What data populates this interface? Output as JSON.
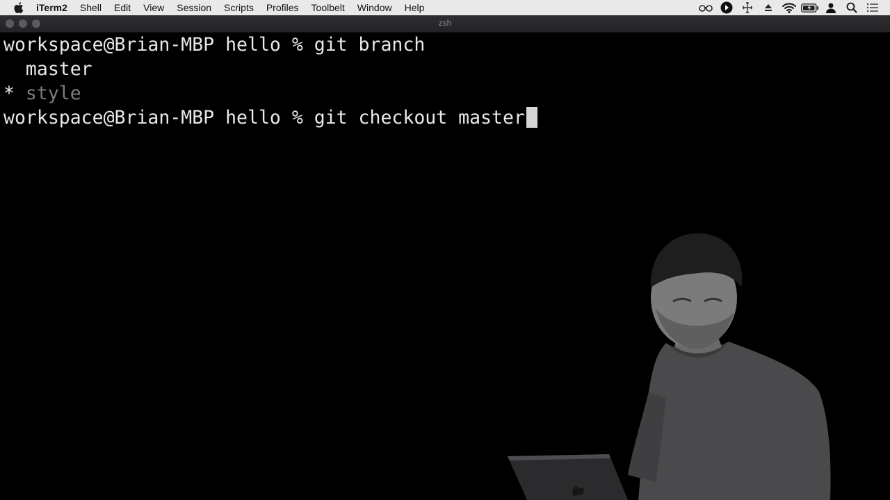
{
  "menubar": {
    "app_name": "iTerm2",
    "items": [
      "Shell",
      "Edit",
      "View",
      "Session",
      "Scripts",
      "Profiles",
      "Toolbelt",
      "Window",
      "Help"
    ],
    "status_icons": [
      "glasses-icon",
      "play-circle-icon",
      "move-icon",
      "eject-icon",
      "wifi-icon",
      "battery-icon",
      "user-icon",
      "search-icon",
      "list-icon"
    ]
  },
  "window": {
    "title": "zsh"
  },
  "terminal": {
    "lines": [
      {
        "prompt": "workspace@Brian-MBP hello % ",
        "command": "git branch"
      },
      {
        "text": "  master"
      },
      {
        "marker": "* ",
        "text": "style"
      },
      {
        "prompt": "workspace@Brian-MBP hello % ",
        "command": "git checkout master"
      }
    ]
  },
  "colors": {
    "menubar_bg": "#e9e9ea",
    "terminal_bg": "#000000",
    "terminal_fg": "#e8e8e8",
    "current_branch": "#7d7d7d"
  }
}
